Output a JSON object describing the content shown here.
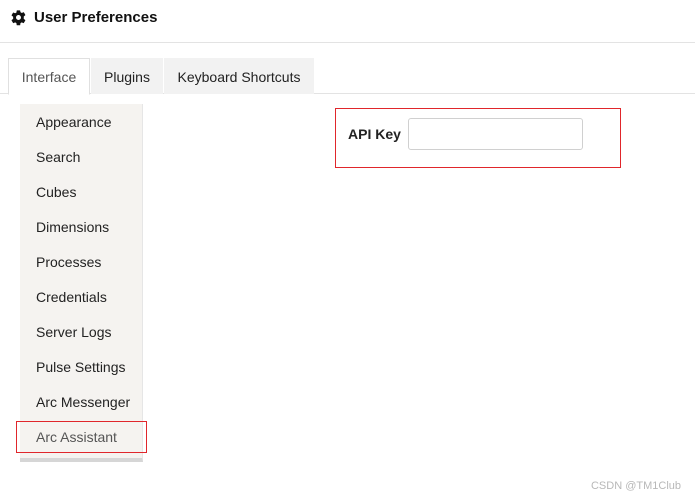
{
  "header": {
    "title": "User Preferences",
    "icon": "gear-icon"
  },
  "tabs": [
    {
      "label": "Interface",
      "active": true
    },
    {
      "label": "Plugins",
      "active": false
    },
    {
      "label": "Keyboard Shortcuts",
      "active": false
    }
  ],
  "sidebar": {
    "items": [
      {
        "label": "Appearance"
      },
      {
        "label": "Search"
      },
      {
        "label": "Cubes"
      },
      {
        "label": "Dimensions"
      },
      {
        "label": "Processes"
      },
      {
        "label": "Credentials"
      },
      {
        "label": "Server Logs"
      },
      {
        "label": "Pulse Settings"
      },
      {
        "label": "Arc Messenger"
      },
      {
        "label": "Arc Assistant",
        "active": true
      }
    ]
  },
  "main": {
    "api_key_label": "API Key",
    "api_key_value": "",
    "api_key_placeholder": ""
  },
  "watermark": "CSDN @TM1Club",
  "colors": {
    "highlight": "#e0262b",
    "sidebar_bg": "#f5f3f0"
  }
}
